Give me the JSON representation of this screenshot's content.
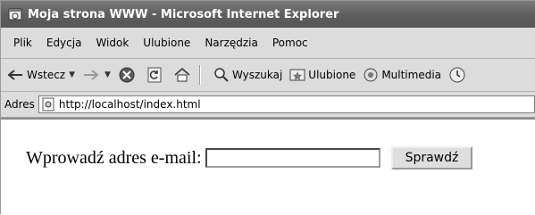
{
  "window": {
    "title": "Moja strona WWW - Microsoft Internet Explorer"
  },
  "menu": [
    "Plik",
    "Edycja",
    "Widok",
    "Ulubione",
    "Narzędzia",
    "Pomoc"
  ],
  "toolbar": {
    "back_label": "Wstecz",
    "search_label": "Wyszukaj",
    "favorites_label": "Ulubione",
    "media_label": "Multimedia"
  },
  "address": {
    "label": "Adres",
    "url": "http://localhost/index.html"
  },
  "page": {
    "email_label": "Wprowadź adres e-mail:",
    "email_value": "",
    "submit_label": "Sprawdź"
  }
}
